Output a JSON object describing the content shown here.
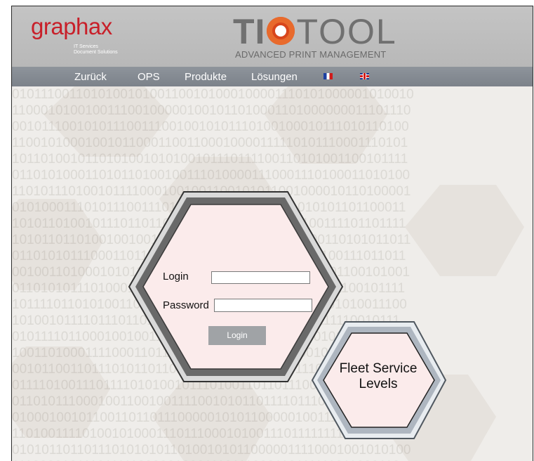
{
  "brand": {
    "name": "graphax",
    "sub_line1": "IT Services",
    "sub_line2": "Document Solutions"
  },
  "logo": {
    "ti": "TI",
    "tool": "TOOL",
    "tagline": "ADVANCED PRINT MANAGEMENT"
  },
  "nav": {
    "items": [
      {
        "label": "Zurück"
      },
      {
        "label": "OPS"
      },
      {
        "label": "Produkte"
      },
      {
        "label": "Lösungen"
      }
    ],
    "flags": [
      "french-flag",
      "uk-flag"
    ]
  },
  "login_form": {
    "login_label": "Login",
    "login_value": "",
    "password_label": "Password",
    "password_value": "",
    "submit_label": "Login"
  },
  "fleet": {
    "line1": "Fleet Service",
    "line2": "Levels"
  },
  "colors": {
    "brand_red": "#c8202a",
    "logo_orange": "#d8461c",
    "nav_bar": "#858b92",
    "hex_fill": "#fbebeb",
    "hex_border": "#6a6a6a",
    "fleet_border": "#a8b0ba",
    "button": "#a0a3a6"
  }
}
